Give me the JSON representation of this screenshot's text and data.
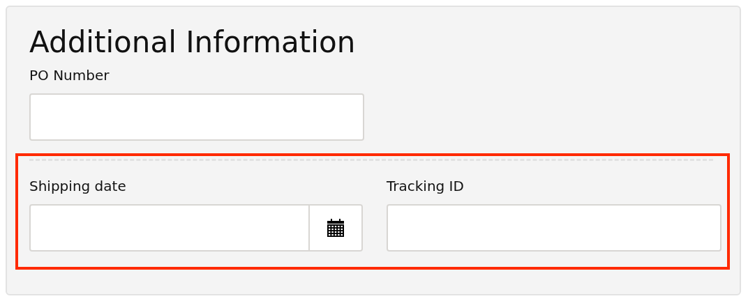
{
  "title": "Additional Information",
  "fields": [
    {
      "label": "PO Number",
      "kind": "text"
    }
  ],
  "highlighted_group": {
    "highlighted": true,
    "fields": [
      {
        "label": "Shipping date",
        "kind": "date"
      },
      {
        "label": "Tracking ID",
        "kind": "text"
      }
    ]
  }
}
